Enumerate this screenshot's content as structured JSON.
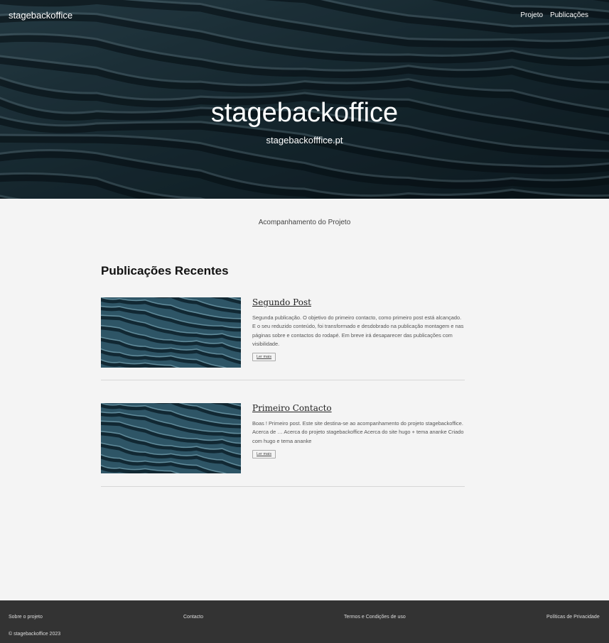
{
  "site": {
    "brand": "stagebackoffice",
    "hero_title": "stagebackoffice",
    "hero_subtitle": "stagebackofffice.pt",
    "tagline": "Acompanhamento do Projeto"
  },
  "nav": {
    "items": [
      "Projeto",
      "Publicações"
    ]
  },
  "posts_section": {
    "title": "Publicações Recentes",
    "posts": [
      {
        "title": "Segundo Post",
        "excerpt": "Segunda publicação. O objetivo do primeiro contacto, como primeiro post está alcançado. E o seu reduzido conteúdo, foi transformado e desdobrado na publicação montagem e nas páginas sobre e contactos do rodapé. Em breve irá desaparecer das publicações com visibilidade.",
        "more_label": "Ler mais"
      },
      {
        "title": "Primeiro Contacto",
        "excerpt": "Boas ! Primeiro post. Este site destina-se ao acompanhamento do projeto stagebackoffice. Acerca de … Acerca do projeto stagebackoffice Acerca do site hugo + tema ananke Criado com hugo e tema ananke",
        "more_label": "Ler mais"
      }
    ]
  },
  "footer": {
    "links": [
      "Sobre o projeto",
      "Contacto",
      "Termos e Condições de uso",
      "Políticas de Privacidade"
    ],
    "copyright": "© stagebackoffice 2023"
  },
  "colors": {
    "hero_base": "#13252d",
    "footer_bg": "#333333",
    "page_bg": "#f4f4f4"
  }
}
